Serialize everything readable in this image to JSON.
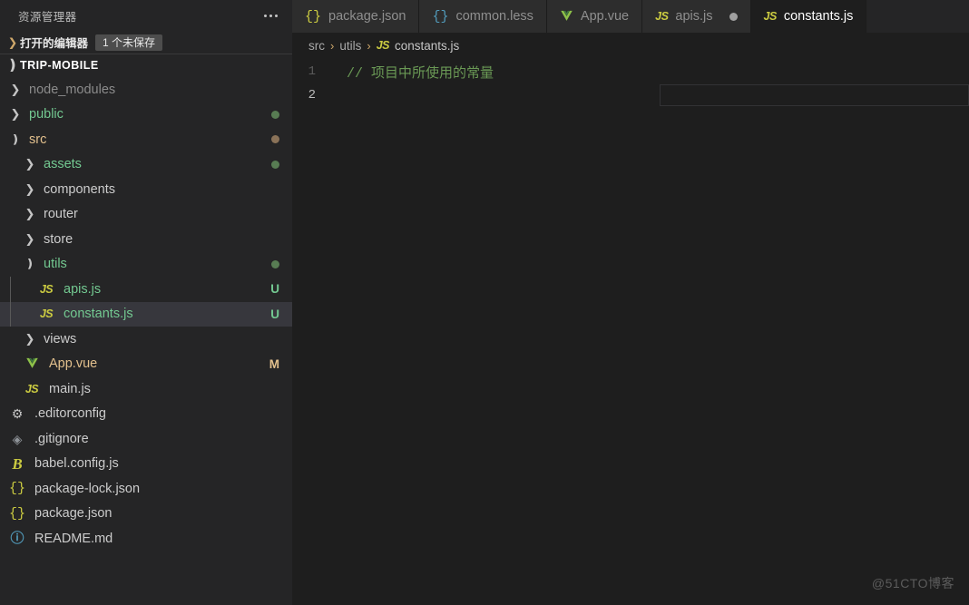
{
  "sidebar": {
    "title": "资源管理器",
    "menu_icon": "ellipsis-icon",
    "open_editors": {
      "label": "打开的编辑器",
      "badge": "1 个未保存",
      "chevron": "chevron-right-icon"
    },
    "root": {
      "label": "TRIP-MOBILE",
      "chevron": "chevron-down-icon"
    },
    "tree": [
      {
        "name": "node_modules",
        "type": "folder",
        "depth": 1,
        "expanded": false,
        "color": "#8b8b8b",
        "icon": "chevron-right-icon",
        "status": "",
        "dot": ""
      },
      {
        "name": "public",
        "type": "folder",
        "depth": 1,
        "expanded": false,
        "color": "#73c991",
        "icon": "chevron-right-icon",
        "status": "",
        "dot": "#587c53"
      },
      {
        "name": "src",
        "type": "folder",
        "depth": 1,
        "expanded": true,
        "color": "#e2c08d",
        "icon": "chevron-down-icon",
        "status": "",
        "dot": "#8a7258"
      },
      {
        "name": "assets",
        "type": "folder",
        "depth": 2,
        "expanded": false,
        "color": "#73c991",
        "icon": "chevron-right-icon",
        "status": "",
        "dot": "#587c53"
      },
      {
        "name": "components",
        "type": "folder",
        "depth": 2,
        "expanded": false,
        "color": "#cccccc",
        "icon": "chevron-right-icon",
        "status": "",
        "dot": ""
      },
      {
        "name": "router",
        "type": "folder",
        "depth": 2,
        "expanded": false,
        "color": "#cccccc",
        "icon": "chevron-right-icon",
        "status": "",
        "dot": ""
      },
      {
        "name": "store",
        "type": "folder",
        "depth": 2,
        "expanded": false,
        "color": "#cccccc",
        "icon": "chevron-right-icon",
        "status": "",
        "dot": ""
      },
      {
        "name": "utils",
        "type": "folder",
        "depth": 2,
        "expanded": true,
        "color": "#73c991",
        "icon": "chevron-down-icon",
        "status": "",
        "dot": "#587c53"
      },
      {
        "name": "apis.js",
        "type": "file",
        "filetype": "js",
        "depth": 3,
        "color": "#73c991",
        "icon": "js-icon",
        "status": "U",
        "status_color": "#73c991",
        "guide": true
      },
      {
        "name": "constants.js",
        "type": "file",
        "filetype": "js",
        "depth": 3,
        "color": "#73c991",
        "icon": "js-icon",
        "status": "U",
        "status_color": "#73c991",
        "selected": true,
        "guide": true
      },
      {
        "name": "views",
        "type": "folder",
        "depth": 2,
        "expanded": false,
        "color": "#cccccc",
        "icon": "chevron-right-icon",
        "status": "",
        "dot": ""
      },
      {
        "name": "App.vue",
        "type": "file",
        "filetype": "vue",
        "depth": 2,
        "color": "#e2c08d",
        "icon": "vue-icon",
        "status": "M",
        "status_color": "#e2c08d"
      },
      {
        "name": "main.js",
        "type": "file",
        "filetype": "js",
        "depth": 2,
        "color": "#cccccc",
        "icon": "js-icon",
        "status": ""
      },
      {
        "name": ".editorconfig",
        "type": "file",
        "filetype": "editorconfig",
        "depth": 1,
        "color": "#cccccc",
        "icon": "gear-icon",
        "status": ""
      },
      {
        "name": ".gitignore",
        "type": "file",
        "filetype": "gitignore",
        "depth": 1,
        "color": "#cccccc",
        "icon": "git-icon",
        "status": ""
      },
      {
        "name": "babel.config.js",
        "type": "file",
        "filetype": "babel",
        "depth": 1,
        "color": "#cccccc",
        "icon": "babel-icon",
        "status": ""
      },
      {
        "name": "package-lock.json",
        "type": "file",
        "filetype": "json",
        "depth": 1,
        "color": "#cccccc",
        "icon": "json-icon",
        "status": ""
      },
      {
        "name": "package.json",
        "type": "file",
        "filetype": "json",
        "depth": 1,
        "color": "#cccccc",
        "icon": "json-icon",
        "status": ""
      },
      {
        "name": "README.md",
        "type": "file",
        "filetype": "md",
        "depth": 1,
        "color": "#cccccc",
        "icon": "markdown-info-icon",
        "status": ""
      }
    ]
  },
  "editor": {
    "tabs": [
      {
        "label": "package.json",
        "icon": "json-icon",
        "icon_kind": "json",
        "active": false,
        "dirty": false
      },
      {
        "label": "common.less",
        "icon": "less-icon",
        "icon_kind": "less",
        "active": false,
        "dirty": false
      },
      {
        "label": "App.vue",
        "icon": "vue-icon",
        "icon_kind": "vue",
        "active": false,
        "dirty": false
      },
      {
        "label": "apis.js",
        "icon": "js-icon",
        "icon_kind": "js",
        "active": false,
        "dirty": true
      },
      {
        "label": "constants.js",
        "icon": "js-icon",
        "icon_kind": "js",
        "active": true,
        "dirty": false
      }
    ],
    "breadcrumb": {
      "parts": [
        "src",
        "utils"
      ],
      "separator": "›",
      "file": "constants.js",
      "file_icon": "js-icon"
    },
    "lines": [
      {
        "number": "1",
        "text": "// 项目中所使用的常量",
        "active": false
      },
      {
        "number": "2",
        "text": "",
        "active": true
      }
    ]
  },
  "watermark": "@51CTO博客",
  "colors": {
    "sidebar_bg": "#252526",
    "editor_bg": "#1e1e1e",
    "tab_inactive_bg": "#2d2d2d",
    "selection_bg": "#37373d",
    "comment_green": "#6a9955",
    "untracked_green": "#73c991",
    "modified_orange": "#e2c08d",
    "js_yellow": "#cbcb41",
    "vue_green": "#8dc149",
    "less_blue": "#519aba"
  }
}
